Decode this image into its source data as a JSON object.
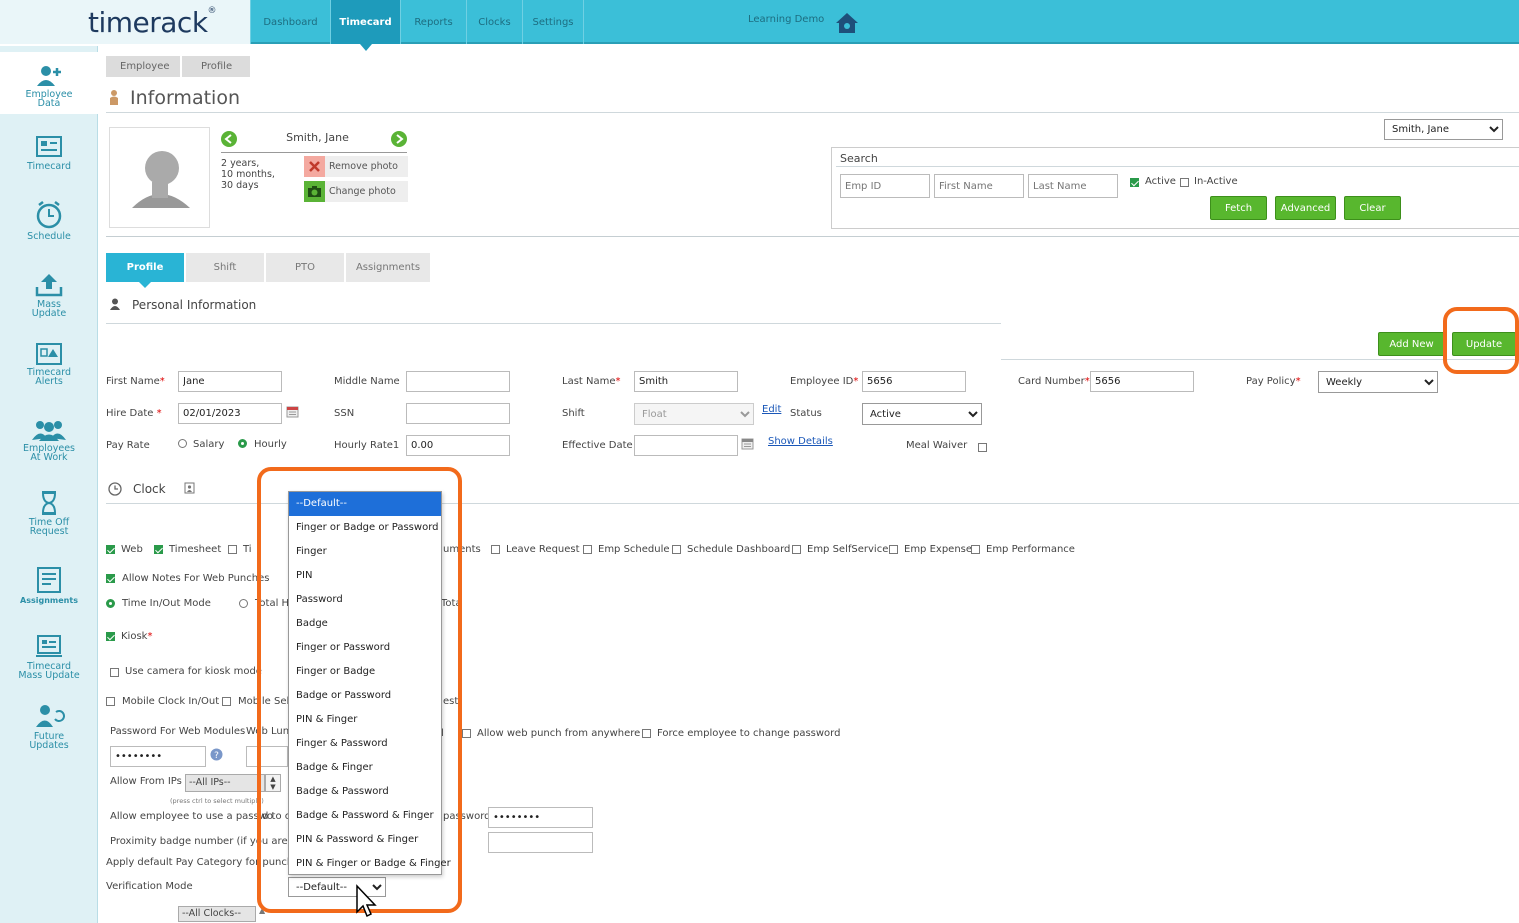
{
  "app": {
    "logo": "timerack",
    "demo_label": "Learning Demo"
  },
  "nav": [
    {
      "label": "Dashboard"
    },
    {
      "label": "Timecard"
    },
    {
      "label": "Reports"
    },
    {
      "label": "Clocks"
    },
    {
      "label": "Settings"
    }
  ],
  "sidebar": [
    {
      "line1": "Employee",
      "line2": "Data"
    },
    {
      "line1": "Timecard",
      "line2": ""
    },
    {
      "line1": "Schedule",
      "line2": ""
    },
    {
      "line1": "Mass",
      "line2": "Update"
    },
    {
      "line1": "Timecard",
      "line2": "Alerts"
    },
    {
      "line1": "Employees",
      "line2": "At Work"
    },
    {
      "line1": "Time Off",
      "line2": "Request"
    },
    {
      "line1": "Assignments",
      "line2": ""
    },
    {
      "line1": "Timecard",
      "line2": "Mass Update"
    },
    {
      "line1": "Future",
      "line2": "Updates"
    }
  ],
  "breadcrumb": {
    "first": "Employee",
    "second": "Profile"
  },
  "page_title": "Information",
  "employee": {
    "name": "Smith, Jane",
    "tenure_1": "2 years,",
    "tenure_2": "10 months,",
    "tenure_3": "30 days",
    "remove_photo": "Remove photo",
    "change_photo": "Change photo",
    "selector_value": "Smith, Jane"
  },
  "search": {
    "title": "Search",
    "emp_id_placeholder": "Emp ID",
    "first_name_placeholder": "First Name",
    "last_name_placeholder": "Last Name",
    "active_label": "Active",
    "inactive_label": "In-Active",
    "fetch": "Fetch",
    "advanced": "Advanced",
    "clear": "Clear"
  },
  "tabs": [
    {
      "label": "Profile"
    },
    {
      "label": "Shift"
    },
    {
      "label": "PTO"
    },
    {
      "label": "Assignments"
    }
  ],
  "personal": {
    "heading": "Personal Information",
    "add_new": "Add New",
    "update": "Update",
    "first_name_label": "First Name",
    "first_name": "Jane",
    "middle_name_label": "Middle Name",
    "last_name_label": "Last Name",
    "last_name": "Smith",
    "employee_id_label": "Employee ID",
    "employee_id": "5656",
    "card_number_label": "Card Number",
    "card_number": "5656",
    "pay_policy_label": "Pay Policy",
    "pay_policy": "Weekly",
    "hire_date_label": "Hire Date",
    "hire_date": "02/01/2023",
    "ssn_label": "SSN",
    "shift_label": "Shift",
    "shift": "Float",
    "edit": "Edit",
    "status_label": "Status",
    "status": "Active",
    "pay_rate_label": "Pay Rate",
    "salary": "Salary",
    "hourly": "Hourly",
    "hourly_rate_label": "Hourly Rate1",
    "hourly_rate": "0.00",
    "effective_date_label": "Effective Date",
    "show_details": "Show Details",
    "meal_waiver_label": "Meal Waiver"
  },
  "clock": {
    "heading": "Clock",
    "modules": [
      "Web",
      "Timesheet",
      "Ti",
      "uments",
      "Leave Request",
      "Emp Schedule",
      "Schedule Dashboard",
      "Emp SelfService",
      "Emp Expense",
      "Emp Performance"
    ],
    "allow_notes": "Allow Notes For Web Punches",
    "time_in_out": "Time In/Out Mode",
    "total_h": "Total H",
    "tota": "Tota",
    "kiosk": "Kiosk",
    "use_camera": "Use camera for kiosk mode",
    "mobile_clock": "Mobile Clock In/Out",
    "mobile_self": "Mobile Self",
    "est": "est",
    "password_label": "Password For Web Modules",
    "password_value": "••••••••",
    "web_lunch": "Web Lunc",
    "allow_web_anywhere": "Allow web punch from anywhere",
    "force_change": "Force employee to change password",
    "allow_from_ips": "Allow From IPs",
    "all_ips": "--All IPs--",
    "ctrl_hint": "(press ctrl to select multiple)",
    "allow_password_to": "Allow employee to use a passwo",
    "to_cl": "d to cl",
    "password_suffix": "password",
    "password2": "••••••••",
    "proximity": "Proximity badge number (if you are usin",
    "apply_default": "Apply default Pay Category for punch",
    "verification_label": "Verification Mode",
    "verification_value": "--Default--",
    "all_clocks": "--All Clocks--"
  },
  "verification_options": [
    "--Default--",
    "Finger or Badge or Password",
    "Finger",
    "PIN",
    "Password",
    "Badge",
    "Finger or Password",
    "Finger or Badge",
    "Badge or Password",
    "PIN & Finger",
    "Finger & Password",
    "Badge & Finger",
    "Badge & Password",
    "Badge & Password & Finger",
    "PIN & Password & Finger",
    "PIN & Finger or Badge & Finger"
  ],
  "colors": {
    "accent": "#3bbfd8",
    "green": "#58b72e",
    "highlight": "#f26a1b",
    "selected": "#1e6fd9"
  }
}
